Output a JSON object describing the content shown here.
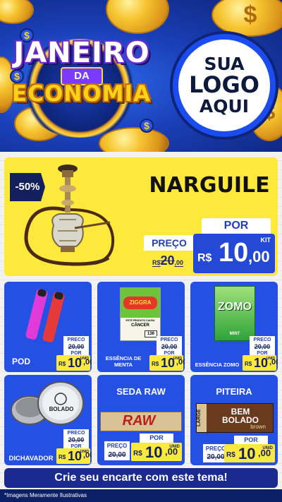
{
  "header": {
    "title_line1": "JANEIRO",
    "title_line2": "DA",
    "title_line3": "ECONOMIA",
    "logo_line1": "SUA",
    "logo_line2": "LOGO",
    "logo_line3": "AQUI",
    "dollar_sign": "$"
  },
  "featured": {
    "discount": "-50%",
    "name": "NARGUILE",
    "por_label": "POR",
    "preco_label": "PREÇO",
    "old_price_prefix": "R$",
    "old_price_int": "20",
    "old_price_dec": ",00",
    "price_currency": "R$",
    "price_int": "10",
    "price_dec": ",00",
    "price_unit": "KIT"
  },
  "products": [
    {
      "name": "POD",
      "preco_label": "PRECO",
      "old_price": "20,00",
      "por_label": "POR",
      "currency": "R$",
      "price_int": "10",
      "price_dec": ",00",
      "unit": "UNID"
    },
    {
      "name_line1": "ESSÊNCIA DE",
      "name_line2": "MENTA",
      "preco_label": "PRECO",
      "old_price": "20,00",
      "por_label": "POR",
      "currency": "R$",
      "price_int": "10",
      "price_dec": ",00",
      "unit": "UNID",
      "pack_brand": "ZIGGRA",
      "pack_warning_title": "ESTE PRODUTO CAUSA",
      "pack_warning_word": "CÂNCER",
      "pack_number": "136"
    },
    {
      "name": "ESSÊNCIA ZOMO",
      "preco_label": "PRECO",
      "old_price": "20,00",
      "por_label": "POR",
      "currency": "R$",
      "price_int": "10",
      "price_dec": ",00",
      "unit": "UNID",
      "pack_brand": "ZOMO",
      "pack_flavor": "MINT"
    },
    {
      "name": "DICHAVADOR",
      "preco_label": "PRECO",
      "old_price": "20,00",
      "por_label": "POR",
      "currency": "R$",
      "price_int": "10",
      "price_dec": ",00",
      "unit": "UNID",
      "item_brand": "BOLADO"
    },
    {
      "name": "SEDA RAW",
      "preco_label": "PREÇO",
      "old_price": "20,00",
      "por_label": "POR",
      "currency": "R$",
      "price_int": "10",
      "price_dec": ",00",
      "unit": "UNID",
      "item_brand": "RAW"
    },
    {
      "name": "PITEIRA",
      "preco_label": "PREÇO",
      "old_price": "20,00",
      "por_label": "POR",
      "currency": "R$",
      "price_int": "10",
      "price_dec": ",00",
      "unit": "UNID",
      "item_brand_line1": "BEM",
      "item_brand_line2": "BOLADO",
      "item_side": "LARGE",
      "item_sub": "brown"
    }
  ],
  "cta": {
    "label": "Crie seu encarte com este tema!"
  },
  "footer": {
    "note": "*Imagens Meramente Ilustrativas"
  },
  "colors": {
    "brand_blue": "#2451e3",
    "navy": "#13205e",
    "yellow": "#fde93b",
    "gold": "#f7c531"
  }
}
